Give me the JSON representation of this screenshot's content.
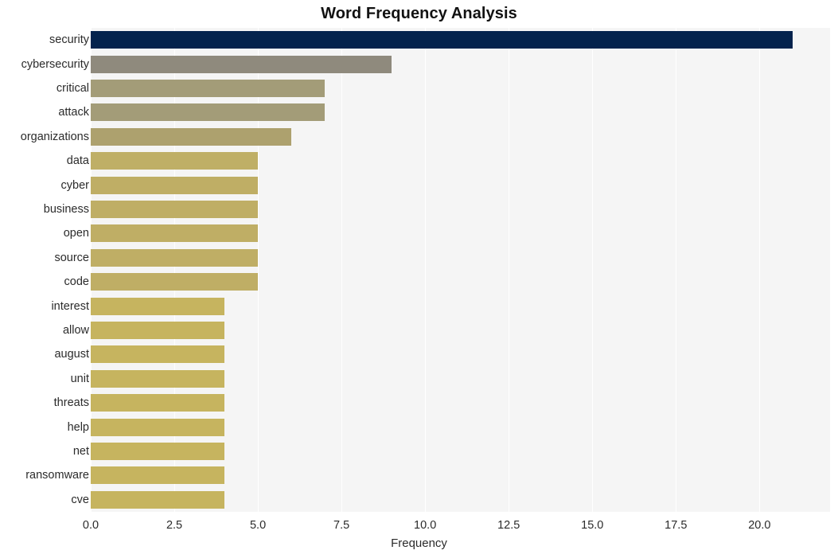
{
  "chart_data": {
    "type": "bar",
    "orientation": "horizontal",
    "title": "Word Frequency Analysis",
    "xlabel": "Frequency",
    "ylabel": "",
    "categories": [
      "security",
      "cybersecurity",
      "critical",
      "attack",
      "organizations",
      "data",
      "cyber",
      "business",
      "open",
      "source",
      "code",
      "interest",
      "allow",
      "august",
      "unit",
      "threats",
      "help",
      "net",
      "ransomware",
      "cve"
    ],
    "values": [
      21,
      9,
      7,
      7,
      6,
      5,
      5,
      5,
      5,
      5,
      5,
      4,
      4,
      4,
      4,
      4,
      4,
      4,
      4,
      4
    ],
    "bar_colors": [
      "#04234d",
      "#8f8a7d",
      "#a39c78",
      "#a39c78",
      "#ada16e",
      "#bfaf66",
      "#bfae65",
      "#bfae65",
      "#bfae65",
      "#bfae65",
      "#bfae65",
      "#c6b45f",
      "#c6b45f",
      "#c6b45f",
      "#c6b45f",
      "#c6b45f",
      "#c6b45f",
      "#c6b45f",
      "#c6b45f",
      "#c6b45f"
    ],
    "xticks": [
      0.0,
      2.5,
      5.0,
      7.5,
      10.0,
      12.5,
      15.0,
      17.5,
      20.0
    ],
    "xtick_labels": [
      "0.0",
      "2.5",
      "5.0",
      "7.5",
      "10.0",
      "12.5",
      "15.0",
      "17.5",
      "20.0"
    ],
    "xlim": [
      0,
      22.11
    ],
    "grid": true,
    "legend": false,
    "plot_background": "#f5f5f5",
    "gridline_color": "#ffffff",
    "figure_background": "#ffffff"
  }
}
